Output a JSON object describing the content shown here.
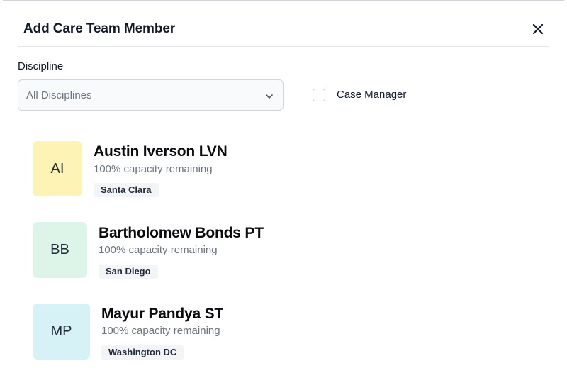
{
  "dialog": {
    "title": "Add Care Team Member",
    "close_icon": "close-icon"
  },
  "filters": {
    "discipline_label": "Discipline",
    "discipline_value": "All Disciplines",
    "chevron_icon": "chevron-down-icon",
    "case_manager_label": "Case Manager",
    "case_manager_checked": false
  },
  "members": [
    {
      "initials": "AI",
      "name": "Austin Iverson LVN",
      "capacity": "100% capacity remaining",
      "location": "Santa Clara",
      "avatar_color": "#fdf3b4"
    },
    {
      "initials": "BB",
      "name": "Bartholomew Bonds PT",
      "capacity": "100% capacity remaining",
      "location": "San Diego",
      "avatar_color": "#ddf5e9"
    },
    {
      "initials": "MP",
      "name": "Mayur Pandya ST",
      "capacity": "100% capacity remaining",
      "location": "Washington DC",
      "avatar_color": "#d7f2f6"
    }
  ]
}
